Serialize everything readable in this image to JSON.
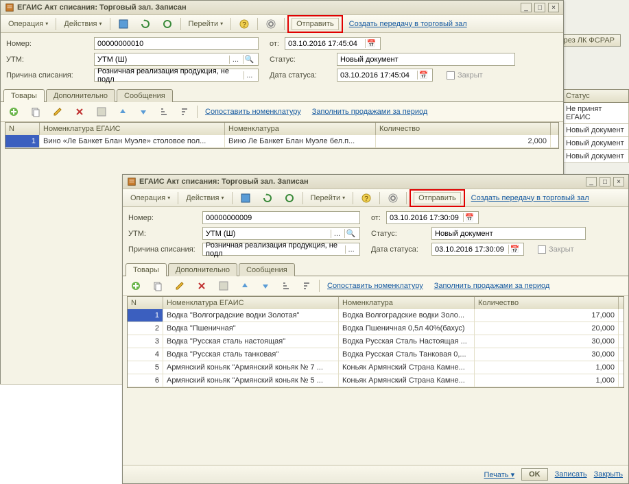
{
  "window1": {
    "title": "ЕГАИС Акт списания: Торговый зал. Записан",
    "toolbar": {
      "operation": "Операция",
      "actions": "Действия",
      "goto": "Перейти",
      "send": "Отправить",
      "create_transfer": "Создать передачу в торговый зал"
    },
    "form": {
      "number_label": "Номер:",
      "number": "00000000010",
      "from_label": "от:",
      "from": "03.10.2016 17:45:04",
      "utm_label": "УТМ:",
      "utm": "УТМ (Ш)",
      "status_label": "Статус:",
      "status": "Новый документ",
      "reason_label": "Причина списания:",
      "reason": "Розничная реализация продукция, не подл",
      "status_date_label": "Дата статуса:",
      "status_date": "03.10.2016 17:45:04",
      "closed": "Закрыт"
    },
    "tabs": {
      "goods": "Товары",
      "extra": "Дополнительно",
      "msgs": "Сообщения"
    },
    "gridbar": {
      "match": "Сопоставить номенклатуру",
      "fill": "Заполнить продажами за период"
    },
    "grid": {
      "headers": {
        "n": "N",
        "nom_egais": "Номенклатура ЕГАИС",
        "nom": "Номенклатура",
        "qty": "Количество"
      },
      "rows": [
        {
          "n": "1",
          "egais": "Вино «Ле Банкет Блан Муэле» столовое пол...",
          "nom": "Вино Ле Банкет Блан Муэле бел.п...",
          "qty": "2,000"
        }
      ]
    }
  },
  "window2": {
    "title": "ЕГАИС Акт списания: Торговый зал. Записан",
    "toolbar": {
      "operation": "Операция",
      "actions": "Действия",
      "goto": "Перейти",
      "send": "Отправить",
      "create_transfer": "Создать передачу в торговый зал"
    },
    "form": {
      "number_label": "Номер:",
      "number": "00000000009",
      "from_label": "от:",
      "from": "03.10.2016 17:30:09",
      "utm_label": "УТМ:",
      "utm": "УТМ (Ш)",
      "status_label": "Статус:",
      "status": "Новый документ",
      "reason_label": "Причина списания:",
      "reason": "Розничная реализация продукция, не подл",
      "status_date_label": "Дата статуса:",
      "status_date": "03.10.2016 17:30:09",
      "closed": "Закрыт"
    },
    "tabs": {
      "goods": "Товары",
      "extra": "Дополнительно",
      "msgs": "Сообщения"
    },
    "gridbar": {
      "match": "Сопоставить номенклатуру",
      "fill": "Заполнить продажами за период"
    },
    "grid": {
      "headers": {
        "n": "N",
        "nom_egais": "Номенклатура ЕГАИС",
        "nom": "Номенклатура",
        "qty": "Количество"
      },
      "rows": [
        {
          "n": "1",
          "egais": "Водка \"Волгоградские водки Золотая\"",
          "nom": "Водка Волгоградские водки Золо...",
          "qty": "17,000"
        },
        {
          "n": "2",
          "egais": "Водка \"Пшеничная\"",
          "nom": "Водка Пшеничная 0,5л 40%(бахус)",
          "qty": "20,000"
        },
        {
          "n": "3",
          "egais": "Водка \"Русская сталь настоящая\"",
          "nom": "Водка Русская Сталь Настоящая ...",
          "qty": "30,000"
        },
        {
          "n": "4",
          "egais": "Водка \"Русская сталь танковая\"",
          "nom": "Водка Русская Сталь Танковая 0,...",
          "qty": "30,000"
        },
        {
          "n": "5",
          "egais": "Армянский коньяк \"Армянский коньяк № 7 ...",
          "nom": "Коньяк Армянский Страна Камне...",
          "qty": "1,000"
        },
        {
          "n": "6",
          "egais": "Армянский коньяк \"Армянский коньяк № 5 ...",
          "nom": "Коньяк Армянский Страна Камне...",
          "qty": "1,000"
        }
      ]
    },
    "footer": {
      "print": "Печать",
      "ok": "OK",
      "save": "Записать",
      "close": "Закрыть"
    }
  },
  "background": {
    "side_btn": "ные марки через ЛК ФСРАР",
    "status_hdr": "Статус",
    "statuses": [
      "Не принят ЕГАИС",
      "Новый документ",
      "Новый документ",
      "Новый документ"
    ]
  }
}
